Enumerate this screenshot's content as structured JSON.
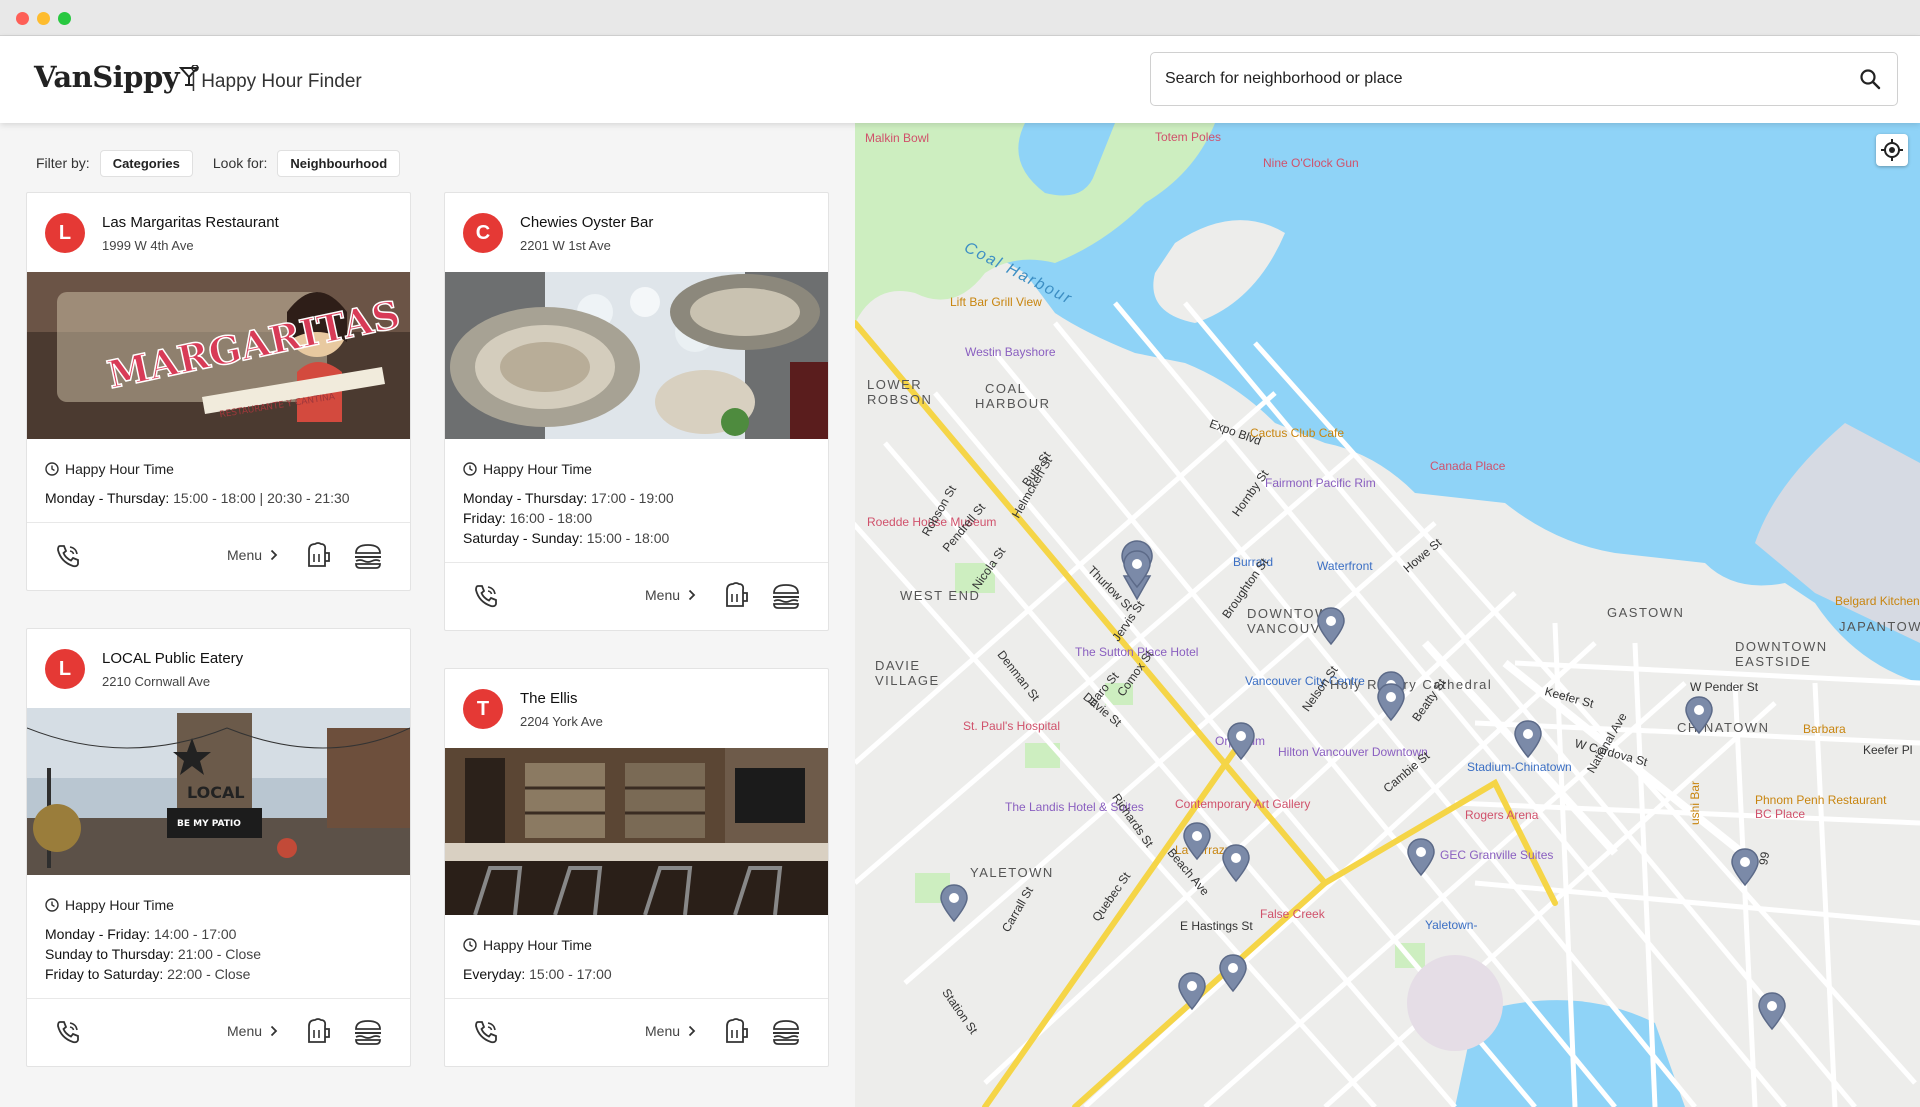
{
  "app": {
    "logo": "VanSippy",
    "subtitle": "| Happy Hour Finder"
  },
  "search": {
    "placeholder": "Search for neighborhood or place",
    "icon": "search-icon"
  },
  "filters": {
    "filter_label": "Filter by:",
    "filter_value": "Categories",
    "look_label": "Look for:",
    "look_value": "Neighbourhood"
  },
  "colors": {
    "accent": "#e53935",
    "water": "#8fd3f7",
    "park": "#cdeec0",
    "road": "#ffffff",
    "major_road": "#f5d547",
    "pin": "#7b8aa8"
  },
  "cards": [
    {
      "initial": "L",
      "name": "Las Margaritas Restaurant",
      "address": "1999 W 4th Ave",
      "happy_label": "Happy Hour Time",
      "hours": [
        {
          "day": "Monday - Thursday:",
          "time": "15:00 - 18:00 | 20:30 - 21:30"
        }
      ],
      "menu": "Menu"
    },
    {
      "initial": "C",
      "name": "Chewies Oyster Bar",
      "address": "2201 W 1st Ave",
      "happy_label": "Happy Hour Time",
      "hours": [
        {
          "day": "Monday - Thursday:",
          "time": "17:00 - 19:00"
        },
        {
          "day": "Friday:",
          "time": "16:00 - 18:00"
        },
        {
          "day": "Saturday - Sunday:",
          "time": "15:00 - 18:00"
        }
      ],
      "menu": "Menu"
    },
    {
      "initial": "L",
      "name": "LOCAL Public Eatery",
      "address": "2210 Cornwall Ave",
      "happy_label": "Happy Hour Time",
      "hours": [
        {
          "day": "Monday - Friday:",
          "time": "14:00 - 17:00"
        },
        {
          "day": "Sunday to Thursday:",
          "time": "21:00 - Close"
        },
        {
          "day": "Friday to Saturday:",
          "time": "22:00 - Close"
        }
      ],
      "menu": "Menu"
    },
    {
      "initial": "T",
      "name": "The Ellis",
      "address": "2204 York Ave",
      "happy_label": "Happy Hour Time",
      "hours": [
        {
          "day": "Everyday:",
          "time": "15:00 - 17:00"
        }
      ],
      "menu": "Menu"
    }
  ],
  "photo_text": {
    "sign1": "MARGARITAS",
    "sign2": "RESTAURANTE Y CANTINA",
    "local": "LOCAL",
    "patio": "BE MY PATIO"
  },
  "map_labels": [
    {
      "t": "Malkin Bowl",
      "c": "#d0516b"
    },
    {
      "t": "Totem Poles",
      "c": "#d0516b"
    },
    {
      "t": "Nine O'Clock Gun",
      "c": "#d0516b"
    },
    {
      "t": "Coal Harbour",
      "c": "#3d8fc4"
    },
    {
      "t": "Lift Bar Grill View",
      "c": "#c8850f"
    },
    {
      "t": "Westin Bayshore",
      "c": "#8a5fc0"
    },
    {
      "t": "LOWER",
      "c": "#555"
    },
    {
      "t": "ROBSON",
      "c": "#555"
    },
    {
      "t": "COAL",
      "c": "#555"
    },
    {
      "t": "HARBOUR",
      "c": "#555"
    },
    {
      "t": "Cactus Club Cafe",
      "c": "#c8850f"
    },
    {
      "t": "Canada Place",
      "c": "#d0516b"
    },
    {
      "t": "Fairmont Pacific Rim",
      "c": "#8a5fc0"
    },
    {
      "t": "Roedde House Museum",
      "c": "#d0516b"
    },
    {
      "t": "Burrard",
      "c": "#3b6fc4"
    },
    {
      "t": "Waterfront",
      "c": "#3b6fc4"
    },
    {
      "t": "WEST END",
      "c": "#555"
    },
    {
      "t": "DOWNTOWN",
      "c": "#555"
    },
    {
      "t": "VANCOUVER",
      "c": "#555"
    },
    {
      "t": "GASTOWN",
      "c": "#555"
    },
    {
      "t": "The Sutton Place Hotel",
      "c": "#8a5fc0"
    },
    {
      "t": "DAVIE",
      "c": "#555"
    },
    {
      "t": "VILLAGE",
      "c": "#555"
    },
    {
      "t": "Vancouver City Centre",
      "c": "#3b6fc4"
    },
    {
      "t": "Holy Rosary Cathedral",
      "c": "#555"
    },
    {
      "t": "St. Paul's Hospital",
      "c": "#d0516b"
    },
    {
      "t": "Orpheum",
      "c": "#8a5fc0"
    },
    {
      "t": "Hilton Vancouver Downtown",
      "c": "#8a5fc0"
    },
    {
      "t": "Stadium-Chinatown",
      "c": "#3b6fc4"
    },
    {
      "t": "DOWNTOWN",
      "c": "#555"
    },
    {
      "t": "EASTSIDE",
      "c": "#555"
    },
    {
      "t": "CHINATOWN",
      "c": "#555"
    },
    {
      "t": "Barbara",
      "c": "#c8850f"
    },
    {
      "t": "Belgard Kitchen",
      "c": "#c8850f"
    },
    {
      "t": "JAPANTOWN",
      "c": "#555"
    },
    {
      "t": "The Landis Hotel & Suites",
      "c": "#8a5fc0"
    },
    {
      "t": "Contemporary Art Gallery",
      "c": "#d0516b"
    },
    {
      "t": "Rogers Arena",
      "c": "#d0516b"
    },
    {
      "t": "Phnom Penh Restaurant",
      "c": "#c8850f"
    },
    {
      "t": "BC Place",
      "c": "#d0516b"
    },
    {
      "t": "GEC Granville Suites",
      "c": "#8a5fc0"
    },
    {
      "t": "YALETOWN",
      "c": "#555"
    },
    {
      "t": "La Terrazza",
      "c": "#c8850f"
    },
    {
      "t": "False Creek",
      "c": "#d0516b"
    },
    {
      "t": "Yaletown-",
      "c": "#3b6fc4"
    },
    {
      "t": "E Hastings St",
      "c": "#333"
    },
    {
      "t": "W Pender St",
      "c": "#333"
    },
    {
      "t": "Keefer St",
      "c": "#333"
    },
    {
      "t": "Keefer Pl",
      "c": "#333"
    },
    {
      "t": "W Cordova St",
      "c": "#333"
    },
    {
      "t": "Expo Blvd",
      "c": "#333"
    },
    {
      "t": "Cambie St",
      "c": "#333"
    },
    {
      "t": "Beatty St",
      "c": "#333"
    },
    {
      "t": "Howe St",
      "c": "#333"
    },
    {
      "t": "Hornby St",
      "c": "#333"
    },
    {
      "t": "Nelson St",
      "c": "#333"
    },
    {
      "t": "Comox St",
      "c": "#333"
    },
    {
      "t": "Haro St",
      "c": "#333"
    },
    {
      "t": "Jervis St",
      "c": "#333"
    },
    {
      "t": "Bute St",
      "c": "#333"
    },
    {
      "t": "Thurlow St",
      "c": "#333"
    },
    {
      "t": "Denman St",
      "c": "#333"
    },
    {
      "t": "Nicola St",
      "c": "#333"
    },
    {
      "t": "Broughton St",
      "c": "#333"
    },
    {
      "t": "Pendrell St",
      "c": "#333"
    },
    {
      "t": "Robson St",
      "c": "#333"
    },
    {
      "t": "Helmcken St",
      "c": "#333"
    },
    {
      "t": "Davie St",
      "c": "#333"
    },
    {
      "t": "Richards St",
      "c": "#333"
    },
    {
      "t": "Beach Ave",
      "c": "#333"
    },
    {
      "t": "Carrall St",
      "c": "#333"
    },
    {
      "t": "Quebec St",
      "c": "#333"
    },
    {
      "t": "Station St",
      "c": "#333"
    },
    {
      "t": "National Ave",
      "c": "#333"
    },
    {
      "t": "ushi Bar",
      "c": "#c8850f"
    },
    {
      "t": "99",
      "c": "#333"
    }
  ]
}
